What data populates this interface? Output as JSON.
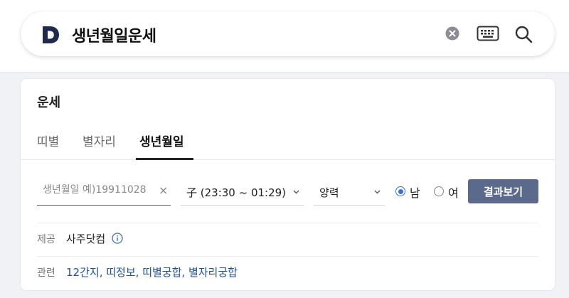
{
  "search": {
    "query": "생년월일운세",
    "logo_letter": "D"
  },
  "card": {
    "title": "운세",
    "tabs": [
      {
        "label": "띠별",
        "active": false
      },
      {
        "label": "별자리",
        "active": false
      },
      {
        "label": "생년월일",
        "active": true
      }
    ],
    "form": {
      "birth_placeholder": "생년월일 예)19911028",
      "clear_symbol": "×",
      "time_value": "子 (23:30 ~ 01:29)",
      "calendar_value": "양력",
      "gender_options": [
        {
          "label": "남",
          "checked": true
        },
        {
          "label": "여",
          "checked": false
        }
      ],
      "submit_label": "결과보기"
    },
    "provider": {
      "label": "제공",
      "name": "사주닷컴"
    },
    "related": {
      "label": "관련",
      "links": [
        "12간지",
        "띠정보",
        "띠별궁합",
        "별자리궁합"
      ]
    }
  },
  "colors": {
    "accent": "#3b6fd6",
    "button": "#5b6a8c",
    "link": "#1a4fa3",
    "logo": "#1f2b4d"
  }
}
